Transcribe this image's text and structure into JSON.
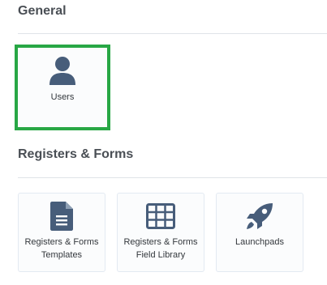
{
  "sections": {
    "general": {
      "title": "General",
      "tiles": {
        "users": {
          "label": "Users",
          "icon": "user-icon",
          "selected": true
        }
      }
    },
    "registers_forms": {
      "title": "Registers & Forms",
      "tiles": {
        "templates": {
          "label": "Registers & Forms Templates",
          "icon": "document-icon"
        },
        "field_library": {
          "label": "Registers & Forms Field Library",
          "icon": "table-icon"
        },
        "launchpads": {
          "label": "Launchpads",
          "icon": "rocket-icon"
        }
      }
    }
  },
  "colors": {
    "icon": "#475d7a",
    "selected_border": "#28a745",
    "divider": "#dfe3e8"
  }
}
